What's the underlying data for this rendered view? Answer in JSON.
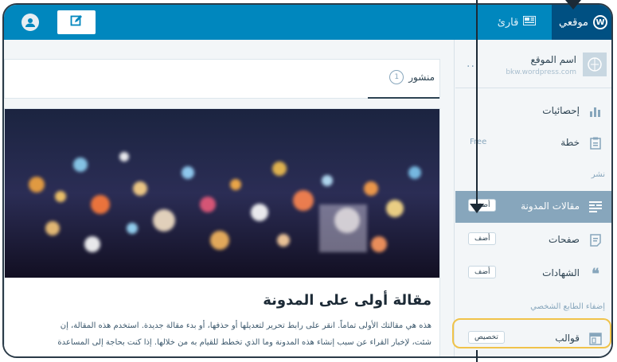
{
  "topbar": {
    "my_site_label": "موقعي",
    "reader_label": "قارئ",
    "avatar_icon": "user-avatar-icon",
    "write_icon": "edit-icon"
  },
  "sidebar": {
    "site_title": "اسم الموقع",
    "site_url": "bkw.wordpress.com",
    "more_label": "...",
    "items": [
      {
        "label": "إحصائيات",
        "icon": "stats-icon"
      },
      {
        "label": "خطة",
        "badge": "Free",
        "icon": "plan-icon"
      }
    ],
    "section_publish": "نشر",
    "publish_items": [
      {
        "label": "مقالات المدونة",
        "button": "أضف",
        "icon": "posts-icon"
      },
      {
        "label": "صفحات",
        "button": "أضف",
        "icon": "pages-icon"
      },
      {
        "label": "الشهادات",
        "button": "أضف",
        "icon": "testimonials-icon"
      }
    ],
    "section_personalize": "إضفاء الطابع الشخصي",
    "themes": {
      "label": "قوالب",
      "button": "تخصيص",
      "icon": "themes-icon"
    }
  },
  "main": {
    "tab_label": "منشور",
    "tab_count": "1",
    "post_title": "مقالة أولى على المدونة",
    "excerpt_line1": "هذه هي مقالتك الأولى تماماً. انقر على رابط تحرير لتعديلها أو حذفها، أو بدء مقالة جديدة. استخدم هذه المقالة، إن",
    "excerpt_line2": "شئت، لإخبار القراء عن سبب إنشاء هذه المدونة وما الذي تخطط للقيام به من خلالها. إذا كنت بحاجة إلى المساعدة",
    "excerpt_line3": "..."
  },
  "colors": {
    "topbar": "#0087be",
    "topbar_active": "#005082",
    "sidebar_active": "#87a6bc",
    "highlight": "#f0c34a"
  }
}
